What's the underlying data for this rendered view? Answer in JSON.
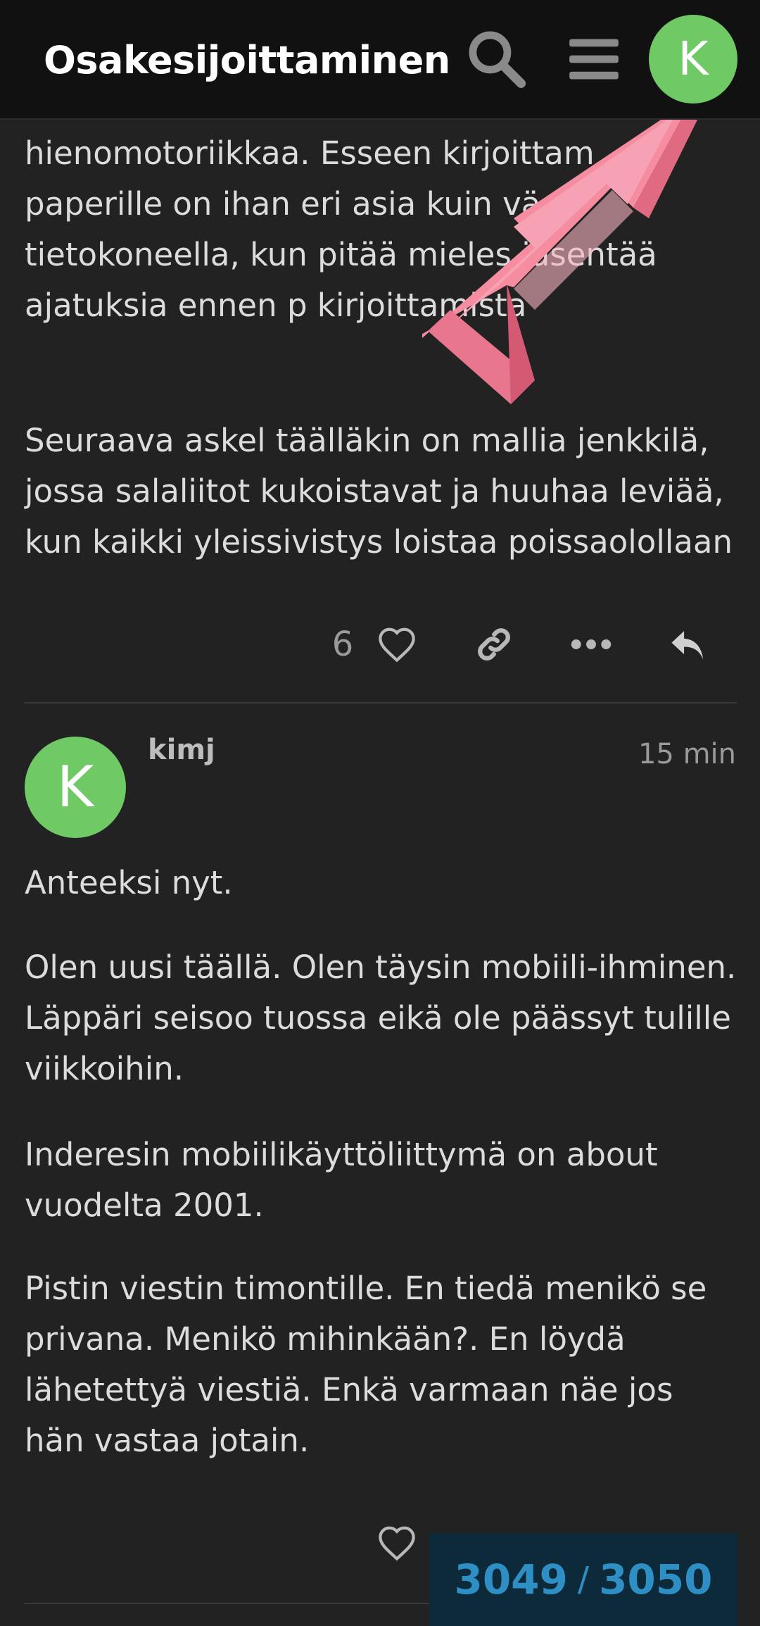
{
  "header": {
    "title": "Osakesijoittaminen",
    "avatar_letter": "K",
    "icons": [
      "search-icon",
      "hamburger-menu-icon",
      "user-avatar"
    ]
  },
  "post1": {
    "paragraphs": [
      "hienomotoriikkaa. Esseen kirjoittam paperille on ihan eri asia kuin väs tietokoneella, kun pitää mieles jäsentää ajatuksia ennen p kirjoittamista",
      "Seuraava askel täälläkin on mallia jenkkilä, jossa salaliitot kukoistavat ja huuhaa leviää, kun kaikki yleissivistys loistaa poissaolollaan"
    ],
    "like_count": "6",
    "actions": [
      "heart-icon",
      "link-icon",
      "more-icon",
      "reply-icon"
    ]
  },
  "post2": {
    "avatar_letter": "K",
    "username": "kimj",
    "time": "15 min",
    "paragraphs": [
      "Anteeksi nyt.",
      "Olen uusi täällä. Olen täysin mobiili-ihminen. Läppäri seisoo tuossa eikä ole päässyt tulille viikkoihin.",
      "Inderesin mobiilikäyttöliittymä on about vuodelta 2001.",
      "Pistin viestin timontille. En tiedä menikö se privana. Menikö mihinkään?. En löydä lähetettyä viestiä. Enkä varmaan näe jos hän vastaa jotain."
    ]
  },
  "timeline": {
    "current": "3049",
    "separator": "/",
    "total": "3050"
  },
  "colors": {
    "background": "#222222",
    "header": "#111111",
    "avatar_green": "#6fc964",
    "timeline_bg": "#0d2a3a",
    "timeline_text": "#2d8fc4",
    "arrow_pink": "#f58ca0"
  }
}
